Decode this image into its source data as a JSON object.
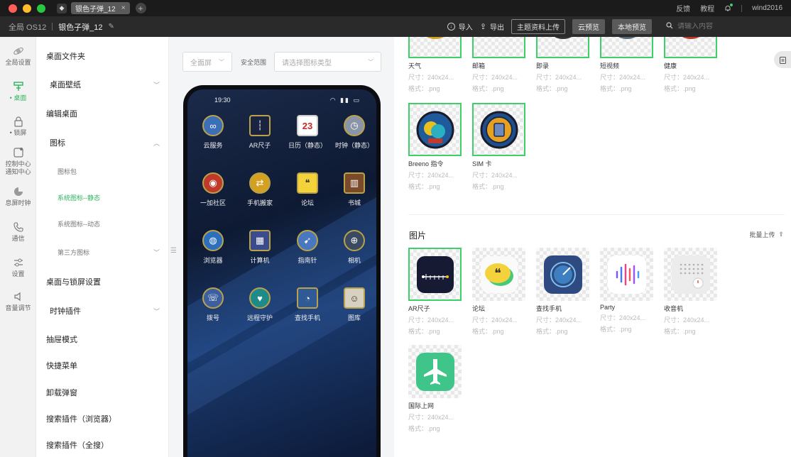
{
  "titlebar": {
    "tab_label": "银色子弹_12",
    "feedback": "反馈",
    "tutorial": "教程",
    "user": "wind2016"
  },
  "topbar": {
    "scope": "全局 OS12",
    "project": "银色子弹_12",
    "import": "导入",
    "export": "导出",
    "upload_theme": "主题资料上传",
    "cloud_preview": "云预览",
    "local_preview": "本地预览",
    "search_placeholder": "请输入内容"
  },
  "iconbar": [
    {
      "label": "全局设置",
      "icon": "planet-icon"
    },
    {
      "label": "• 桌面",
      "icon": "desktop-icon",
      "active": true
    },
    {
      "label": "• 锁屏",
      "icon": "lock-icon"
    },
    {
      "label": "控制中心\n通知中心",
      "icon": "control-icon"
    },
    {
      "label": "息屏时钟",
      "icon": "clock-icon"
    },
    {
      "label": "通信",
      "icon": "phone-icon"
    },
    {
      "label": "设置",
      "icon": "settings-icon"
    },
    {
      "label": "音量调节",
      "icon": "volume-icon"
    }
  ],
  "menu": {
    "desktop_folder": "桌面文件夹",
    "desktop_wallpaper": "桌面壁纸",
    "edit_desktop": "编辑桌面",
    "icons": "图标",
    "icon_pack": "图标包",
    "system_static": "系统图标--静态",
    "system_dynamic": "系统图标--动态",
    "third_party": "第三方图标",
    "desktop_lock_settings": "桌面与锁屏设置",
    "clock_plugin": "时钟插件",
    "drawer_mode": "抽屉模式",
    "shortcut_menu": "快捷菜单",
    "uninstall_popup": "卸载弹窗",
    "search_browser": "搜索插件（浏览器）",
    "search_all": "搜索插件（全搜）"
  },
  "preview": {
    "screen_select": "全面屏",
    "safe_range_label": "安全范围",
    "icon_type_placeholder": "请选择图标类型",
    "time": "19:30",
    "calendar_day": "23",
    "apps": [
      {
        "label": "云服务"
      },
      {
        "label": "AR尺子"
      },
      {
        "label": "日历（静态）"
      },
      {
        "label": "时钟（静态）"
      },
      {
        "label": "一加社区"
      },
      {
        "label": "手机搬家"
      },
      {
        "label": "论坛"
      },
      {
        "label": "书城"
      },
      {
        "label": "浏览器"
      },
      {
        "label": "计算机"
      },
      {
        "label": "指南针"
      },
      {
        "label": "相机"
      },
      {
        "label": "拨号"
      },
      {
        "label": "远程守护"
      },
      {
        "label": "查找手机"
      },
      {
        "label": "图库"
      }
    ]
  },
  "panel": {
    "icons_top": [
      {
        "name": "天气",
        "size": "尺寸：240x24...",
        "format": "格式：.png"
      },
      {
        "name": "邮箱",
        "size": "尺寸：240x24...",
        "format": "格式：.png"
      },
      {
        "name": "即录",
        "size": "尺寸：240x24...",
        "format": "格式：.png"
      },
      {
        "name": "短视频",
        "size": "尺寸：240x24...",
        "format": "格式：.png"
      },
      {
        "name": "健康",
        "size": "尺寸：240x24...",
        "format": "格式：.png"
      }
    ],
    "icons_row2": [
      {
        "name": "Breeno 指令",
        "size": "尺寸：240x24...",
        "format": "格式：.png"
      },
      {
        "name": "SIM 卡",
        "size": "尺寸：240x24...",
        "format": "格式：.png"
      }
    ],
    "images_title": "图片",
    "batch_upload": "批量上传",
    "images": [
      {
        "name": "AR尺子",
        "size": "尺寸：240x24...",
        "format": "格式：.png"
      },
      {
        "name": "论坛",
        "size": "尺寸：240x24...",
        "format": "格式：.png"
      },
      {
        "name": "查找手机",
        "size": "尺寸：240x24...",
        "format": "格式：.png"
      },
      {
        "name": "Party",
        "size": "尺寸：240x24...",
        "format": "格式：.png"
      },
      {
        "name": "收音机",
        "size": "尺寸：240x24...",
        "format": "格式：.png"
      },
      {
        "name": "国际上网",
        "size": "尺寸：240x24...",
        "format": "格式：.png"
      }
    ]
  },
  "colors": {
    "accent": "#2db55d",
    "selected_border": "#3ecf6b",
    "titlebar_bg": "#1b1b1b",
    "topbar_bg": "#2a2a2a"
  }
}
